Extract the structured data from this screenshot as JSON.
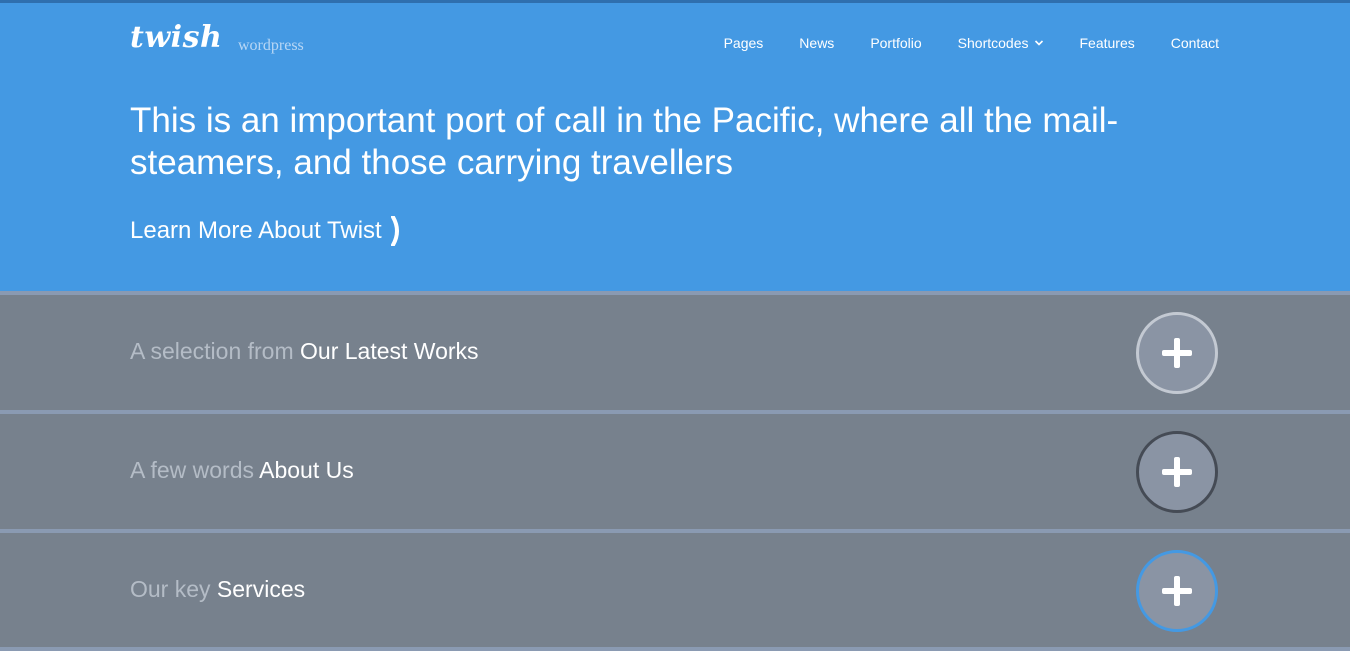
{
  "header": {
    "logo": "twish",
    "tagline": "wordpress"
  },
  "nav": {
    "items": [
      {
        "label": "Pages"
      },
      {
        "label": "News"
      },
      {
        "label": "Portfolio"
      },
      {
        "label": "Shortcodes",
        "icon": "chevron-down-icon"
      },
      {
        "label": "Features"
      },
      {
        "label": "Contact"
      }
    ]
  },
  "hero": {
    "headline": "This is an important port of call in the Pacific, where all the mail-steamers, and those carrying travellers",
    "cta": "Learn More About Twist",
    "cta_icon": "chevron-right-icon"
  },
  "sections": [
    {
      "muted": "A selection from",
      "strong": "Our Latest Works",
      "button_icon": "plus-icon",
      "button_border": "#c3c9d2"
    },
    {
      "muted": "A few words",
      "strong": "About Us",
      "button_icon": "plus-icon",
      "button_border": "#454b55"
    },
    {
      "muted": "Our key",
      "strong": "Services",
      "button_icon": "plus-icon",
      "button_border": "#4499e3"
    }
  ],
  "colors": {
    "hero_bg": "#4499e3",
    "section_bg": "#77818d",
    "divider": "#8a9ab2"
  }
}
